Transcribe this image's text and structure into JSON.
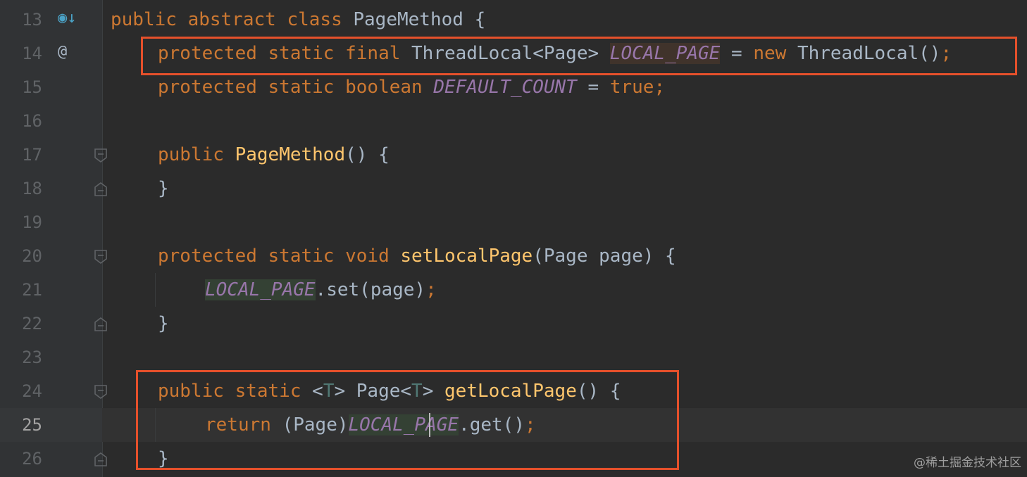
{
  "editor": {
    "colors": {
      "background": "#2b2b2b",
      "keyword": "#cc7832",
      "method": "#ffc66d",
      "static_field": "#9876aa",
      "type_param": "#507874",
      "plain": "#a9b7c6",
      "highlight_box": "#e5502b"
    },
    "line_numbers": [
      "13",
      "14",
      "15",
      "16",
      "17",
      "18",
      "19",
      "20",
      "21",
      "22",
      "23",
      "24",
      "25",
      "26"
    ],
    "gutter_icons": {
      "l13": "◉↓",
      "l14": "@"
    },
    "code": {
      "l13": {
        "kw": "public abstract class ",
        "name": "PageMethod",
        "rest": " {"
      },
      "l14": {
        "kw": "protected static final ",
        "type": "ThreadLocal<Page> ",
        "field": "LOCAL_PAGE",
        "eq": " = ",
        "new": "new ",
        "ctor": "ThreadLocal()",
        "semi": ";"
      },
      "l15": {
        "kw": "protected static boolean ",
        "field": "DEFAULT_COUNT",
        "eq": " = ",
        "val": "true",
        "semi": ";"
      },
      "l17": {
        "kw": "public ",
        "fn": "PageMethod",
        "rest": "() {"
      },
      "l18": {
        "rest": "}"
      },
      "l20": {
        "kw": "protected static void ",
        "fn": "setLocalPage",
        "rest": "(Page page) {"
      },
      "l21": {
        "field": "LOCAL_PAGE",
        "rest": ".set(page)",
        "semi": ";"
      },
      "l22": {
        "rest": "}"
      },
      "l24": {
        "kw": "public static ",
        "lt": "<",
        "tp1": "T",
        "gt": "> Page<",
        "tp2": "T",
        "gt2": "> ",
        "fn": "getLocalPage",
        "rest": "() {"
      },
      "l25": {
        "kw": "return ",
        "cast": "(Page)",
        "field_a": "LOCAL_",
        "field_b": "PAGE",
        "rest": ".get()",
        "semi": ";"
      },
      "l26": {
        "rest": "}"
      }
    }
  },
  "watermark": "@稀土掘金技术社区"
}
